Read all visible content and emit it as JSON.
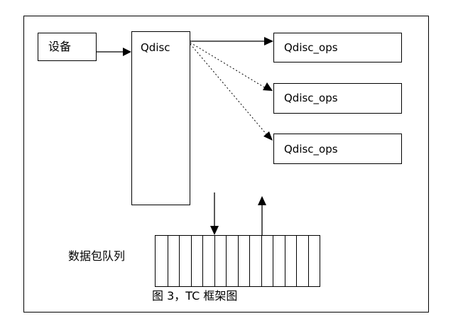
{
  "diagram": {
    "device_label": "设备",
    "qdisc_label": "Qdisc",
    "qdisc_ops_labels": [
      "Qdisc_ops",
      "Qdisc_ops",
      "Qdisc_ops"
    ],
    "queue_label": "数据包队列",
    "queue_cells": 14,
    "caption": "图 3，TC 框架图"
  }
}
